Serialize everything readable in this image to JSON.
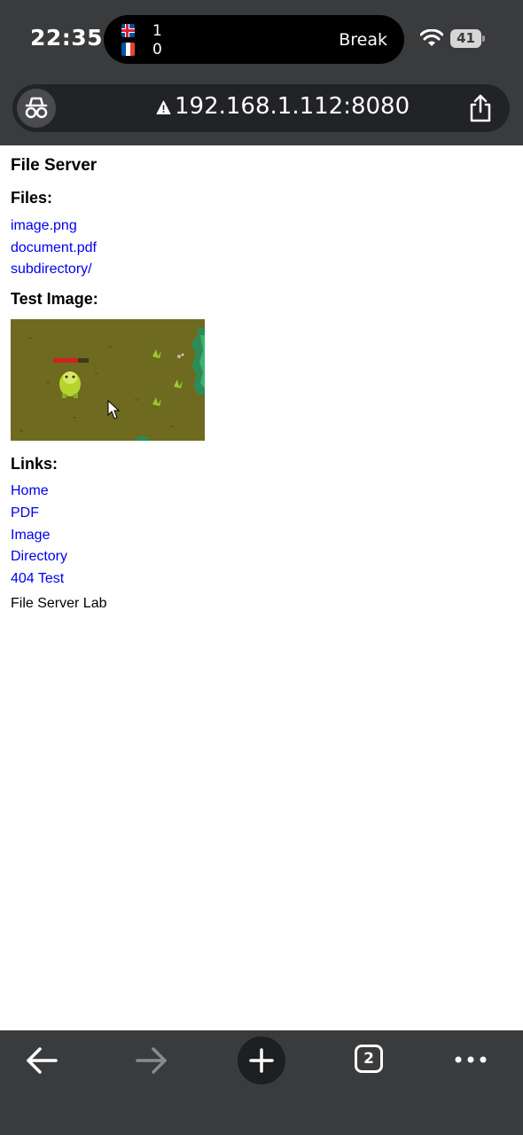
{
  "status_bar": {
    "time": "22:35",
    "live_activity": {
      "team1_flag": "iceland-flag",
      "team1_score": "1",
      "team2_flag": "france-flag",
      "team2_score": "0",
      "match_status": "Break"
    },
    "battery_level": "41"
  },
  "address_bar": {
    "url": "192.168.1.112:8080",
    "security_icon": "warning-icon",
    "left_icon": "incognito-icon",
    "right_icon": "share-icon"
  },
  "page": {
    "title": "File Server",
    "files_heading": "Files:",
    "files": [
      "image.png",
      "document.pdf",
      "subdirectory/"
    ],
    "test_image_heading": "Test Image:",
    "links_heading": "Links:",
    "links": [
      "Home",
      "PDF",
      "Image",
      "Directory",
      "404 Test"
    ],
    "footer": "File Server Lab"
  },
  "toolbar": {
    "tab_count": "2",
    "icons": [
      "back-arrow-icon",
      "forward-arrow-icon",
      "plus-icon",
      "tabs-icon",
      "more-icon"
    ]
  },
  "colors": {
    "chrome_bg": "#3a3b3d",
    "link": "#0000ee",
    "image_grass": "#6e6a1f"
  }
}
